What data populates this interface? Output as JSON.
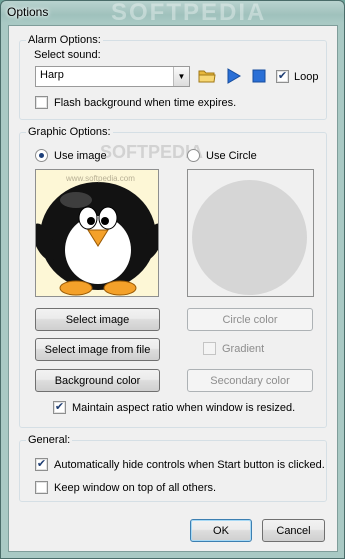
{
  "window": {
    "title": "Options",
    "watermark": "SOFTPEDIA"
  },
  "alarm": {
    "group_label": "Alarm Options:",
    "select_sound_label": "Select sound:",
    "sound_value": "Harp",
    "loop_label": "Loop",
    "loop_checked": true,
    "flash_label": "Flash background when time expires.",
    "flash_checked": false
  },
  "graphic": {
    "group_label": "Graphic Options:",
    "use_image_label": "Use image",
    "use_circle_label": "Use Circle",
    "selected": "image",
    "image_watermark": "www.softpedia.com",
    "preview_watermark": "SOFTPEDIA",
    "select_image_button": "Select image",
    "select_image_file_button": "Select image from file",
    "background_color_button": "Background color",
    "circle_color_button": "Circle color",
    "gradient_label": "Gradient",
    "secondary_color_button": "Secondary color",
    "aspect_label": "Maintain aspect ratio when window is resized.",
    "aspect_checked": true,
    "circle_fill": "#d6d6d6",
    "image_background": "#fdf7d6"
  },
  "general": {
    "group_label": "General:",
    "autohide_label": "Automatically hide controls when Start button is clicked.",
    "autohide_checked": true,
    "ontop_label": "Keep window on top of all others.",
    "ontop_checked": false
  },
  "footer": {
    "ok_button": "OK",
    "cancel_button": "Cancel"
  },
  "colors": {
    "accent": "#2a6fd6",
    "window_frame": "#a9c9c4"
  }
}
